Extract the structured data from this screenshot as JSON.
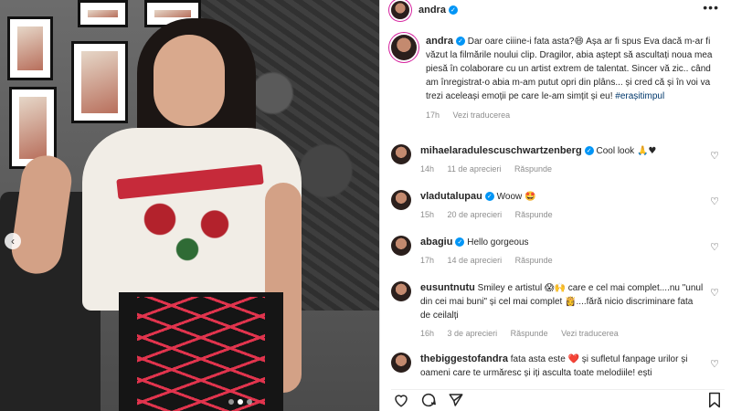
{
  "post": {
    "author": "andra",
    "caption_author": "andra",
    "caption_text": "Dar oare ciiine-i fata asta?",
    "caption_emoji_1": "😄",
    "caption_text_2": " Așa ar fi spus Eva dacă m-ar fi văzut la filmările noului clip. Dragilor, abia aștept să ascultați noua mea piesă în colaborare cu un artist extrem de talentat. Sincer vă zic.. când am înregistrat-o abia m-am putut opri din plâns... și cred că și în voi va trezi aceleași emoții pe care le-am simțit și eu! ",
    "hashtag": "#erașitimpul",
    "time": "17h",
    "translate": "Vezi traducerea"
  },
  "comments": [
    {
      "user": "mihaelaradulescuschwartzenberg",
      "verified": true,
      "text": "Cool look",
      "emoji": "🙏♥",
      "time": "14h",
      "likes": "11 de aprecieri",
      "reply": "Răspunde",
      "translate": ""
    },
    {
      "user": "vladutalupau",
      "verified": true,
      "text": "Woow",
      "emoji": "🤩",
      "time": "15h",
      "likes": "20 de aprecieri",
      "reply": "Răspunde",
      "translate": ""
    },
    {
      "user": "abagiu",
      "verified": true,
      "text": "Hello gorgeous",
      "emoji": "",
      "time": "17h",
      "likes": "14 de aprecieri",
      "reply": "Răspunde",
      "translate": ""
    },
    {
      "user": "eusuntnutu",
      "verified": false,
      "text": "Smiley e artistul",
      "emoji": "😱🙌",
      "text_2": " care e cel mai complet....nu \"unul din cei mai buni\" și cel mai complet",
      "emoji_2": "👸",
      "text_3": "....fără nicio discriminare fata de ceilalți",
      "time": "16h",
      "likes": "3 de aprecieri",
      "reply": "Răspunde",
      "translate": "Vezi traducerea"
    },
    {
      "user": "thebiggestofandra",
      "verified": false,
      "text": "fata asta este",
      "emoji": "❤️",
      "text_2": " și sufletul fanpage urilor și oameni care te urmăresc și iți asculta toate melodiile! ești",
      "time": "",
      "likes": "",
      "reply": "",
      "translate": ""
    }
  ],
  "icons": {
    "header_more": "more-options-icon",
    "verified": "verified-badge-icon",
    "comment_like": "heart-outline-icon",
    "like": "heart-icon",
    "comment": "comment-icon",
    "share": "share-icon",
    "save": "bookmark-icon",
    "carousel_prev": "chevron-left-icon"
  },
  "colors": {
    "verified": "#0095f6",
    "hashtag": "#00376b",
    "muted": "#8e8e8e",
    "text": "#262626",
    "story_ring": "#d6249f"
  }
}
